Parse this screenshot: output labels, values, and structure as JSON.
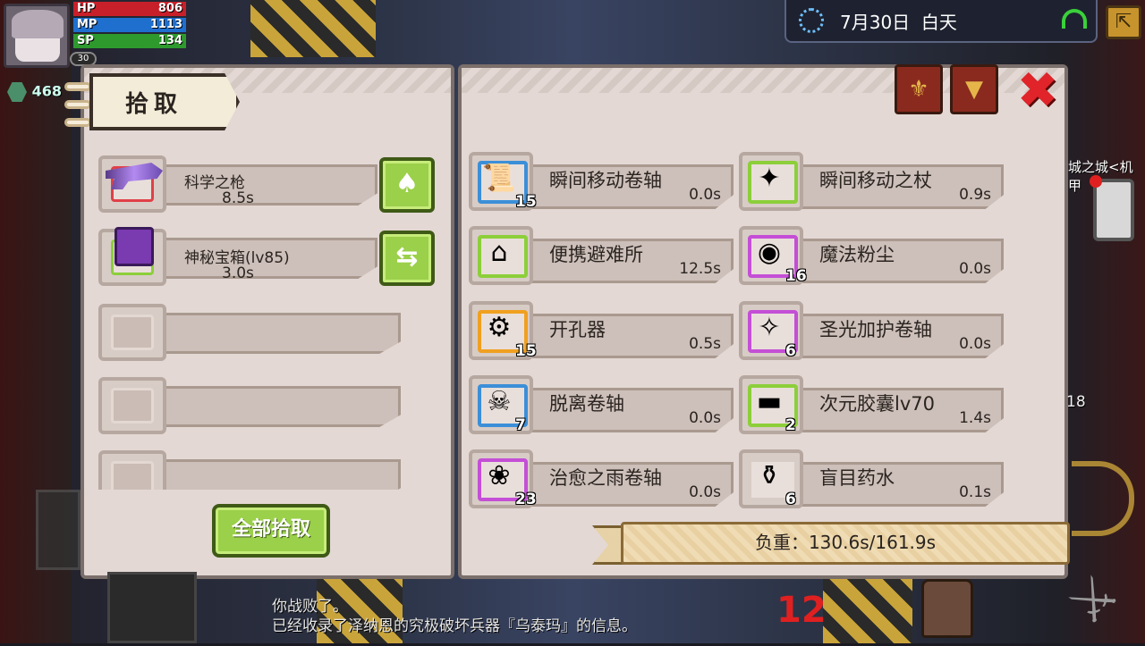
{
  "hud": {
    "hp_label": "HP",
    "hp_value": "806",
    "mp_label": "MP",
    "mp_value": "1113",
    "sp_label": "SP",
    "sp_value": "134",
    "level": "30",
    "gems": "468",
    "date": "7月30日",
    "time_of_day": "白天",
    "city_label": "城之城<机甲",
    "bag_count": "18"
  },
  "pickup_panel": {
    "title": "拾取",
    "slots": [
      {
        "name": "科学之枪",
        "time": "8.5s",
        "icon": "sci-fi-gun-icon"
      },
      {
        "name": "神秘宝箱(lv85)",
        "time": "3.0s",
        "icon": "mystery-chest-icon"
      },
      {
        "name": "",
        "time": ""
      },
      {
        "name": "",
        "time": ""
      },
      {
        "name": "",
        "time": ""
      }
    ],
    "pick_all_label": "全部拾取",
    "side_buttons": [
      "bag-icon",
      "swap-icon"
    ]
  },
  "inventory": {
    "items": [
      {
        "name": "瞬间移动卷轴",
        "time": "0.0s",
        "qty": "15",
        "frame_color": "#3b8fd8",
        "icon": "scroll-icon"
      },
      {
        "name": "瞬间移动之杖",
        "time": "0.9s",
        "qty": "",
        "frame_color": "#8ccf3a",
        "icon": "wand-icon"
      },
      {
        "name": "便携避难所",
        "time": "12.5s",
        "qty": "",
        "frame_color": "#8ccf3a",
        "icon": "shelter-icon"
      },
      {
        "name": "魔法粉尘",
        "time": "0.0s",
        "qty": "16",
        "frame_color": "#c44fd6",
        "icon": "magic-dust-icon"
      },
      {
        "name": "开孔器",
        "time": "0.5s",
        "qty": "15",
        "frame_color": "#f0a020",
        "icon": "drill-icon"
      },
      {
        "name": "圣光加护卷轴",
        "time": "0.0s",
        "qty": "6",
        "frame_color": "#c44fd6",
        "icon": "green-scroll-icon"
      },
      {
        "name": "脱离卷轴",
        "time": "0.0s",
        "qty": "7",
        "frame_color": "#3b8fd8",
        "icon": "skull-scroll-icon"
      },
      {
        "name": "次元胶囊lv70",
        "time": "1.4s",
        "qty": "2",
        "frame_color": "#8ccf3a",
        "icon": "capsule-icon"
      },
      {
        "name": "治愈之雨卷轴",
        "time": "0.0s",
        "qty": "23",
        "frame_color": "#c44fd6",
        "icon": "heal-scroll-icon"
      },
      {
        "name": "盲目药水",
        "time": "0.1s",
        "qty": "6",
        "frame_color": "#d8ccc6",
        "icon": "potion-icon"
      }
    ],
    "weight_label": "负重：130.6s/161.9s"
  },
  "log": {
    "line1": "你战败了。",
    "line2": "已经收录了泽纳恩的究极破坏兵器『乌泰玛』的信息。"
  },
  "bottom": {
    "counter": "12"
  }
}
